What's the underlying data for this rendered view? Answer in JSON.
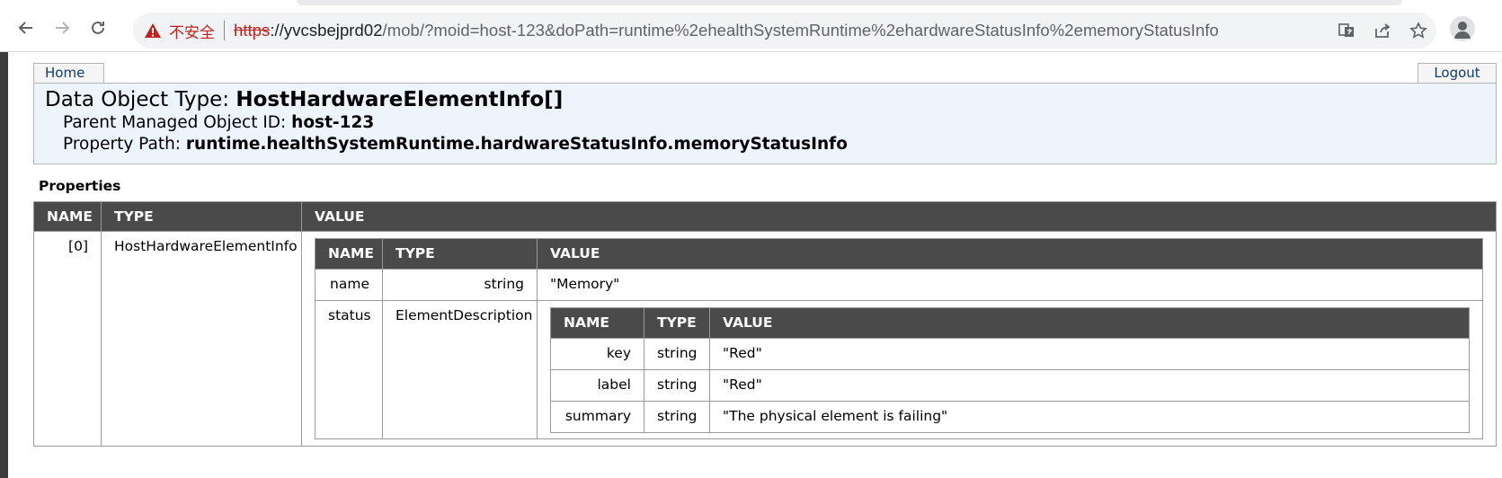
{
  "browser": {
    "security_label": "不安全",
    "url_scheme": "https",
    "url_host": "://yvcsbejprd02",
    "url_path": "/mob/?moid=host-123&doPath=runtime%2ehealthSystemRuntime%2ehardwareStatusInfo%2ememoryStatusInfo"
  },
  "nav": {
    "home": "Home",
    "logout": "Logout"
  },
  "header": {
    "type_label": "Data Object Type: ",
    "type_value": "HostHardwareElementInfo[]",
    "parent_label": "Parent Managed Object ID: ",
    "parent_value": "host-123",
    "path_label": "Property Path: ",
    "path_value": "runtime.healthSystemRuntime.hardwareStatusInfo.memoryStatusInfo"
  },
  "properties": {
    "title": "Properties",
    "headers": {
      "name": "NAME",
      "type": "TYPE",
      "value": "VALUE"
    },
    "row": {
      "name": "[0]",
      "type": "HostHardwareElementInfo"
    },
    "inner": {
      "rows": [
        {
          "name": "name",
          "type": "string",
          "value": "\"Memory\""
        },
        {
          "name": "status",
          "type": "ElementDescription"
        }
      ],
      "status_rows": [
        {
          "name": "key",
          "type": "string",
          "value": "\"Red\""
        },
        {
          "name": "label",
          "type": "string",
          "value": "\"Red\""
        },
        {
          "name": "summary",
          "type": "string",
          "value": "\"The physical element is failing\""
        }
      ]
    }
  }
}
